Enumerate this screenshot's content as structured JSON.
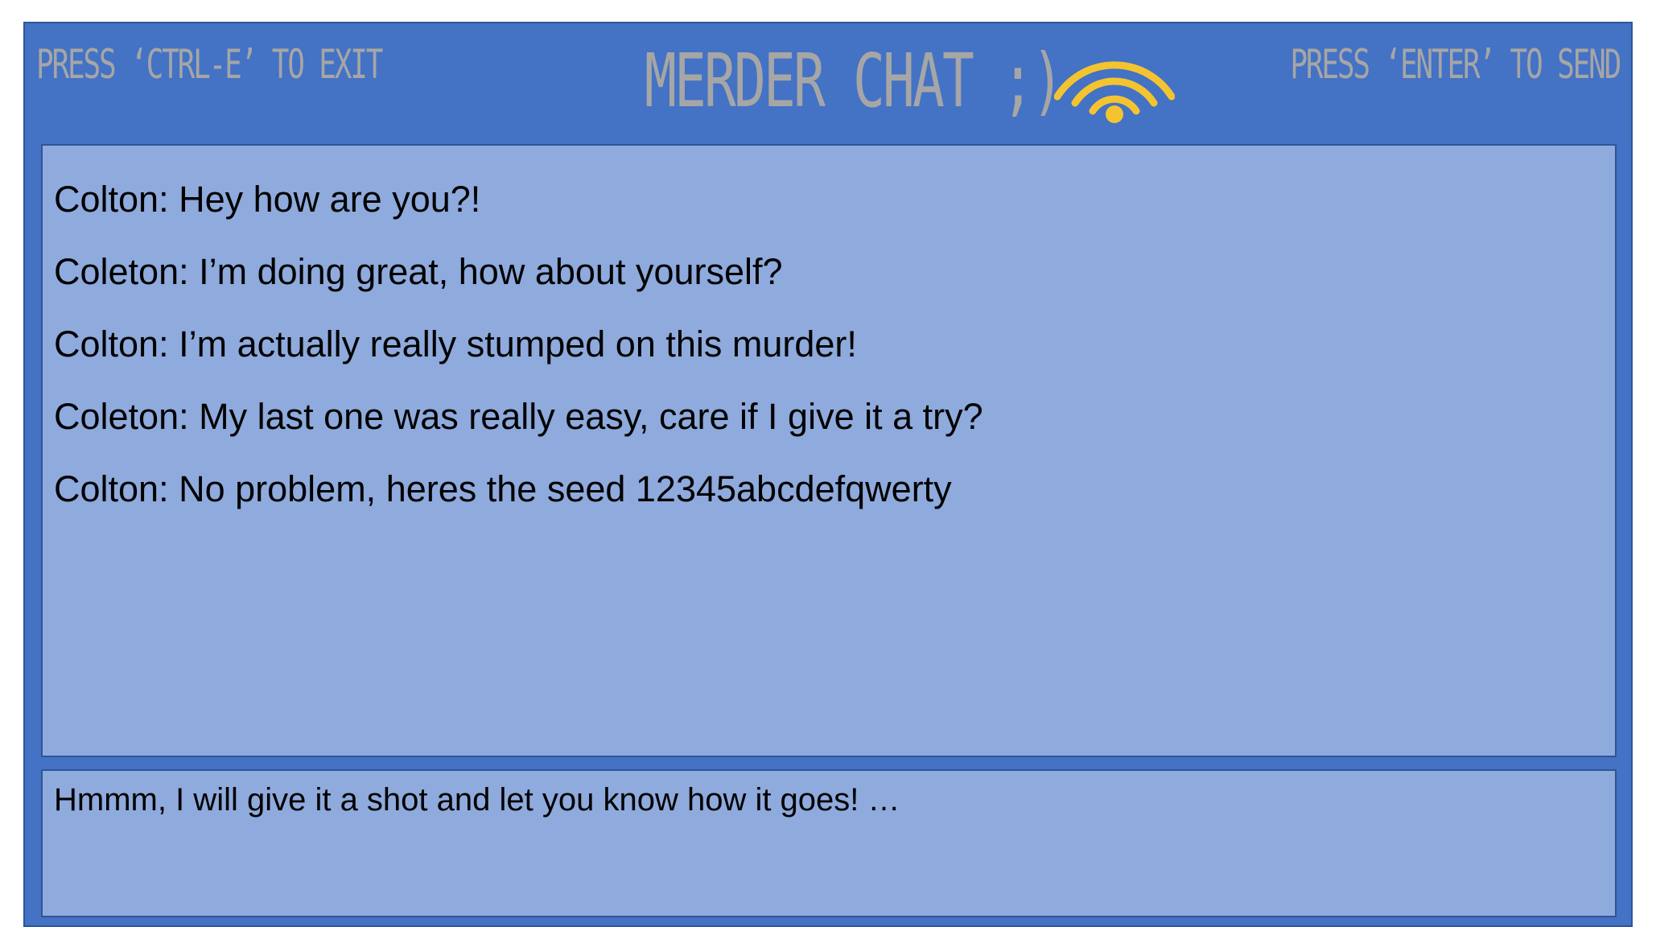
{
  "header": {
    "exit_hint": "Press ‘Ctrl-E’ to exit",
    "title": "Merder Chat ;)",
    "send_hint": "Press ‘Enter’ to send",
    "signal_icon": "wifi-icon"
  },
  "messages": [
    {
      "text": "Colton: Hey how are you?!"
    },
    {
      "text": "Coleton: I’m doing great, how about yourself?"
    },
    {
      "text": "Colton: I’m actually really stumped on this murder!"
    },
    {
      "text": "Coleton: My last one was really easy, care if I give it a try?"
    },
    {
      "text": "Colton: No problem, heres the seed 12345abcdefqwerty"
    }
  ],
  "compose": {
    "value": "Hmmm, I will give it a shot and let you know how it goes! …"
  },
  "colors": {
    "frame": "#4472c4",
    "panel": "#8faadc",
    "border": "#2f5597",
    "header_text": "#a6a6a6",
    "wifi": "#f4c430"
  }
}
